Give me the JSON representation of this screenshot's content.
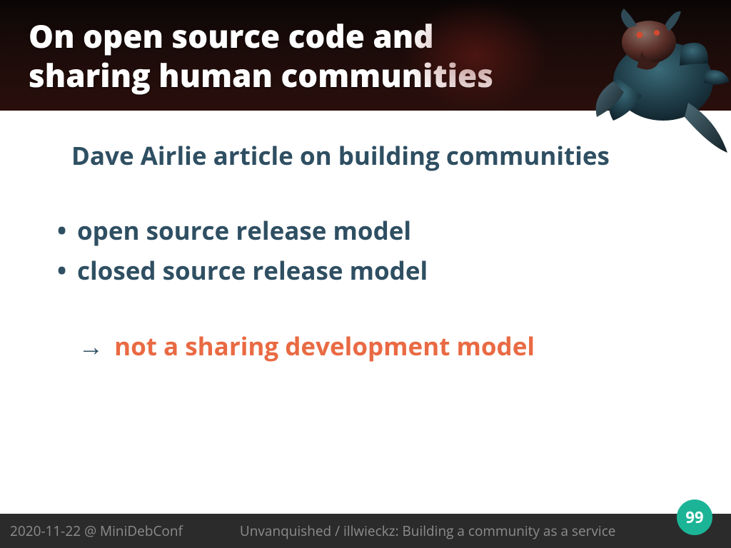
{
  "header": {
    "title": "On open source code and sharing human communities"
  },
  "body": {
    "subtitle": "Dave Airlie article on building communities",
    "bullets": [
      "open source release model",
      "closed source release model"
    ],
    "conclusion_arrow": "→",
    "conclusion_text": "not a sharing development model"
  },
  "footer": {
    "date_venue": "2020-11-22 @ MiniDebConf",
    "talk": "Unvanquished / illwieckz: Building a community as a service",
    "page": "99"
  },
  "colors": {
    "text_primary": "#2f4f62",
    "accent": "#e96a43",
    "badge": "#1bb496"
  }
}
